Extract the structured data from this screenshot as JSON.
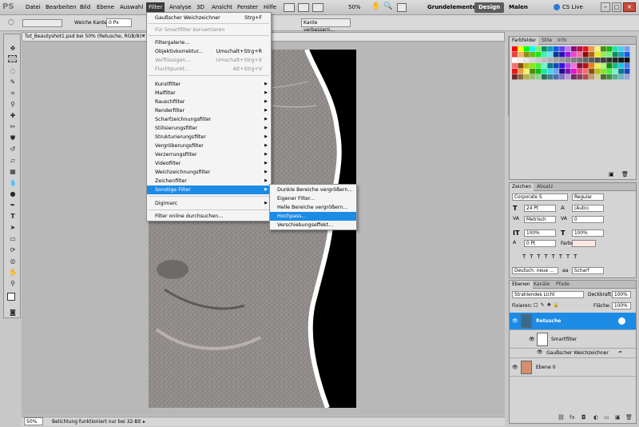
{
  "app": {
    "logo": "PS"
  },
  "menubar": {
    "items": [
      "Datei",
      "Bearbeiten",
      "Bild",
      "Ebene",
      "Auswahl",
      "Filter",
      "Analyse",
      "3D",
      "Ansicht",
      "Fenster",
      "Hilfe"
    ],
    "zoom": "50%",
    "workspaces": [
      "Grundelemente",
      "Design",
      "Malen"
    ],
    "cs_live": "CS Live"
  },
  "options": {
    "soft_edge_label": "Weiche Kante:",
    "soft_edge_value": "0 Px",
    "refine_edge": "Kante verbessern..."
  },
  "document": {
    "tab_title": "Tut_Beautyshot1.psd bei 50% (Retusche, RGB/8) *"
  },
  "status": {
    "zoom": "50%",
    "message": "Belichtung funktioniert nur bei 32-Bit"
  },
  "filter_menu": {
    "items": [
      {
        "label": "Gaußscher Weichzeichner",
        "shortcut": "Strg+F"
      },
      {
        "label": "Für Smartfilter konvertieren",
        "disabled": true
      },
      {
        "label": "Filtergalerie..."
      },
      {
        "label": "Objektivkorrektur...",
        "shortcut": "Umschalt+Strg+R"
      },
      {
        "label": "Verflüssigen...",
        "shortcut": "Umschalt+Strg+X",
        "disabled": true
      },
      {
        "label": "Fluchtpunkt...",
        "shortcut": "Alt+Strg+V",
        "disabled": true
      },
      {
        "label": "Kunstfilter",
        "submenu": true
      },
      {
        "label": "Malfilter",
        "submenu": true
      },
      {
        "label": "Rauschfilter",
        "submenu": true
      },
      {
        "label": "Renderfilter",
        "submenu": true
      },
      {
        "label": "Scharfzeichnungsfilter",
        "submenu": true
      },
      {
        "label": "Stilisierungsfilter",
        "submenu": true
      },
      {
        "label": "Strukturierungsfilter",
        "submenu": true
      },
      {
        "label": "Vergröberungsfilter",
        "submenu": true
      },
      {
        "label": "Verzerrungsfilter",
        "submenu": true
      },
      {
        "label": "Videofilter",
        "submenu": true
      },
      {
        "label": "Weichzeichnungsfilter",
        "submenu": true
      },
      {
        "label": "Zeichenfilter",
        "submenu": true
      },
      {
        "label": "Sonstige Filter",
        "submenu": true,
        "highlighted": true
      },
      {
        "label": "Digimarc",
        "submenu": true
      },
      {
        "label": "Filter online durchsuchen..."
      }
    ]
  },
  "sonstige_submenu": {
    "items": [
      {
        "label": "Dunkle Bereiche vergrößern..."
      },
      {
        "label": "Eigener Filter..."
      },
      {
        "label": "Helle Bereiche vergrößern..."
      },
      {
        "label": "Hochpass...",
        "highlighted": true
      },
      {
        "label": "Verschiebungseffekt..."
      }
    ]
  },
  "swatches_panel": {
    "tabs": [
      "Farbfelder",
      "Stile",
      "Info"
    ]
  },
  "character_panel": {
    "tabs": [
      "Zeichen",
      "Absatz"
    ],
    "font_family": "Corporate S",
    "font_style": "Regular",
    "font_size": "24 Pt",
    "leading": "(Auto)",
    "kerning": "Metrisch",
    "tracking": "0",
    "vertical_scale": "100%",
    "horizontal_scale": "100%",
    "baseline_shift": "0 Pt",
    "color_label": "Farbe:",
    "language": "Deutsch: neue ...",
    "antialias": "Scharf"
  },
  "layers_panel": {
    "tabs": [
      "Ebenen",
      "Kanäle",
      "Pfade"
    ],
    "blend_mode": "Strahlendes Licht",
    "opacity_label": "Deckkraft:",
    "opacity": "100%",
    "lock_label": "Fixieren:",
    "fill_label": "Fläche:",
    "fill": "100%",
    "layers": [
      {
        "name": "Retusche",
        "selected": true
      },
      {
        "name": "Smartfilter"
      },
      {
        "name": "Gaußscher Weichzeichner"
      },
      {
        "name": "Ebene 0"
      }
    ]
  },
  "colors": {
    "menu_highlight": "#1c8be6",
    "canvas_bg": "#000000"
  }
}
